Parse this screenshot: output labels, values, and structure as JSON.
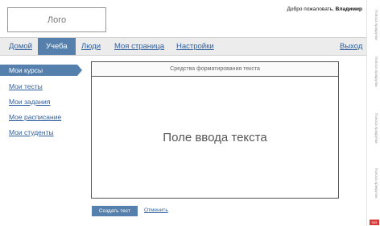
{
  "header": {
    "logo_text": "Лого",
    "welcome_prefix": "Добро пожаловать,",
    "user_name": "Владимир"
  },
  "nav": {
    "items": [
      {
        "label": "Домой"
      },
      {
        "label": "Учеба",
        "active": true
      },
      {
        "label": "Люди"
      },
      {
        "label": "Моя страница"
      },
      {
        "label": "Настройки"
      }
    ],
    "logout": "Выход"
  },
  "sidebar": {
    "items": [
      {
        "label": "Мои курсы",
        "active": true
      },
      {
        "label": "Мои тесты"
      },
      {
        "label": "Мои задания"
      },
      {
        "label": "Мое расписание"
      },
      {
        "label": "Мои студенты"
      }
    ]
  },
  "editor": {
    "toolbar_text": "Средства форматирования текста",
    "placeholder_text": "Поле ввода текста"
  },
  "actions": {
    "create_label": "Создать тест",
    "cancel_label": "Отменить"
  },
  "gutter": {
    "labels": [
      "Полоса прокрутки",
      "Полоса прокрутки",
      "Полоса прокрутки",
      "Полоса прокрутки"
    ],
    "badge": "505"
  },
  "colors": {
    "accent": "#5580ae",
    "link": "#2f5f9e",
    "navbar_bg": "#ececec",
    "badge": "#d83a3a"
  }
}
